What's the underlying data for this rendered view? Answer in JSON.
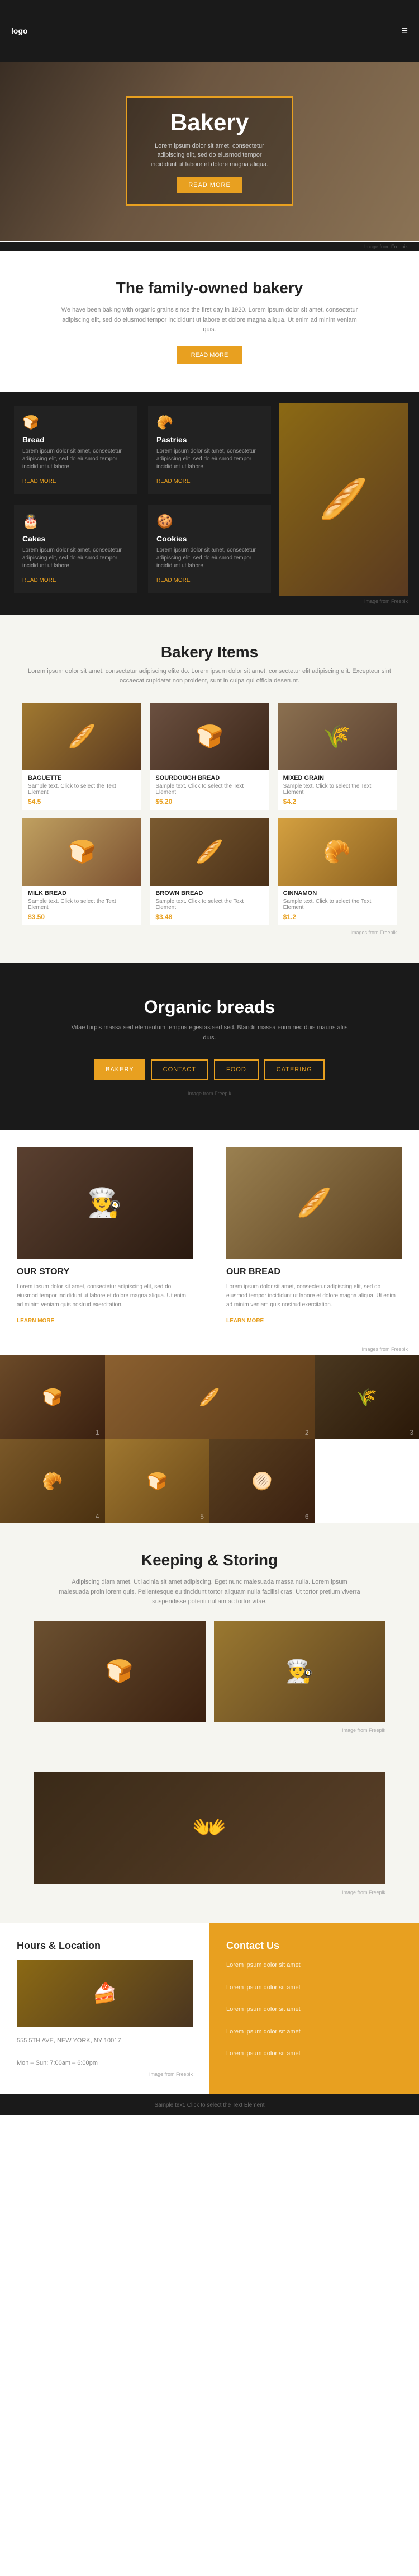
{
  "header": {
    "logo": "logo",
    "menu_icon": "≡"
  },
  "hero": {
    "title": "Bakery",
    "subtitle": "Lorem ipsum dolor sit amet, consectetur adipiscing elit, sed do eiusmod tempor incididunt ut labore et dolore magna aliqua.",
    "button": "READ MORE",
    "image_caption": "Image from Freepik"
  },
  "family": {
    "title": "The family-owned bakery",
    "text": "We have been baking with organic grains since the first day in 1920. Lorem ipsum dolor sit amet, consectetur adipiscing elit, sed do eiusmod tempor incididunt ut labore et dolore magna aliqua. Ut enim ad minim veniam quis.",
    "button": "READ MORE"
  },
  "products": [
    {
      "icon": "🍞",
      "name": "Bread",
      "desc": "Lorem ipsum dolor sit amet, consectetur adipiscing elit, sed do eiusmod tempor incididunt ut labore.",
      "link": "READ MORE"
    },
    {
      "icon": "🥐",
      "name": "Pastries",
      "desc": "Lorem ipsum dolor sit amet, consectetur adipiscing elit, sed do eiusmod tempor incididunt ut labore.",
      "link": "READ MORE"
    },
    {
      "icon": "🎂",
      "name": "Cakes",
      "desc": "Lorem ipsum dolor sit amet, consectetur adipiscing elit, sed do eiusmod tempor incididunt ut labore.",
      "link": "READ MORE"
    },
    {
      "icon": "🍪",
      "name": "Cookies",
      "desc": "Lorem ipsum dolor sit amet, consectetur adipiscing elit, sed do eiusmod tempor incididunt ut labore.",
      "link": "READ MORE"
    }
  ],
  "products_caption": "Image from Freepik",
  "bakery_items": {
    "title": "Bakery Items",
    "desc": "Lorem ipsum dolor sit amet, consectetur adipiscing elite do. Lorem ipsum dolor sit amet, consectetur elit adipiscing elit. Excepteur sint occaecat cupidatat non proident, sunt in culpa qui officia deserunt.",
    "items": [
      {
        "name": "BAGUETTE",
        "sample": "Sample text. Click to select the Text Element",
        "price": "$4.5"
      },
      {
        "name": "SOURDOUGH BREAD",
        "sample": "Sample text. Click to select the Text Element",
        "price": "$5.20"
      },
      {
        "name": "MIXED GRAIN",
        "sample": "Sample text. Click to select the Text Element",
        "price": "$4.2"
      },
      {
        "name": "MILK BREAD",
        "sample": "Sample text. Click to select the Text Element",
        "price": "$3.50"
      },
      {
        "name": "BROWN BREAD",
        "sample": "Sample text. Click to select the Text Element",
        "price": "$3.48"
      },
      {
        "name": "CINNAMON",
        "sample": "Sample text. Click to select the Text Element",
        "price": "$1.2"
      }
    ],
    "image_caption": "Images from Freepik"
  },
  "organic": {
    "title": "Organic breads",
    "desc": "Vitae turpis massa sed elementum tempus egestas sed sed. Blandit massa enim nec duis mauris aliis duis.",
    "buttons": [
      "BAKERY",
      "CONTACT",
      "FOOD",
      "CATERING"
    ],
    "image_caption": "Image from Freepik"
  },
  "story": {
    "our_story": {
      "title": "OUR STORY",
      "text": "Lorem ipsum dolor sit amet, consectetur adipiscing elit, sed do eiusmod tempor incididunt ut labore et dolore magna aliqua. Ut enim ad minim veniam quis nostrud exercitation.",
      "link": "LEARN MORE"
    },
    "our_bread": {
      "title": "OUR BREAD",
      "text": "Lorem ipsum dolor sit amet, consectetur adipiscing elit, sed do eiusmod tempor incididunt ut labore et dolore magna aliqua. Ut enim ad minim veniam quis nostrud exercitation.",
      "link": "LEARN MORE"
    },
    "image_caption": "Images from Freepik"
  },
  "keeping": {
    "title": "Keeping & Storing",
    "text": "Adipiscing diam amet. Ut lacinia sit amet adipiscing. Eget nunc malesuada massa nulla. Lorem ipsum malesuada proin lorem quis. Pellentesque eu tincidunt tortor aliquam nulla facilisi cras. Ut tortor pretium viverra suspendisse potenti nullam ac tortor vitae.",
    "image_caption": "Image from Freepik"
  },
  "baking": {
    "image_caption": "Image from Freepik"
  },
  "footer": {
    "hours": {
      "title": "Hours & Location",
      "address_line1": "555 5TH AVE, NEW YORK, NY 10017",
      "address_line2": "Mon – Sun: 7:00am – 6:00pm",
      "image_caption": "Image from Freepik"
    },
    "contact": {
      "title": "Contact Us",
      "lines": [
        "Lorem ipsum dolor sit amet",
        "Lorem ipsum dolor sit amet",
        "Lorem ipsum dolor sit amet",
        "Lorem ipsum dolor sit amet",
        "Lorem ipsum dolor sit amet"
      ]
    }
  },
  "footer_bottom": {
    "text": "Sample text. Click to select the Text Element"
  }
}
